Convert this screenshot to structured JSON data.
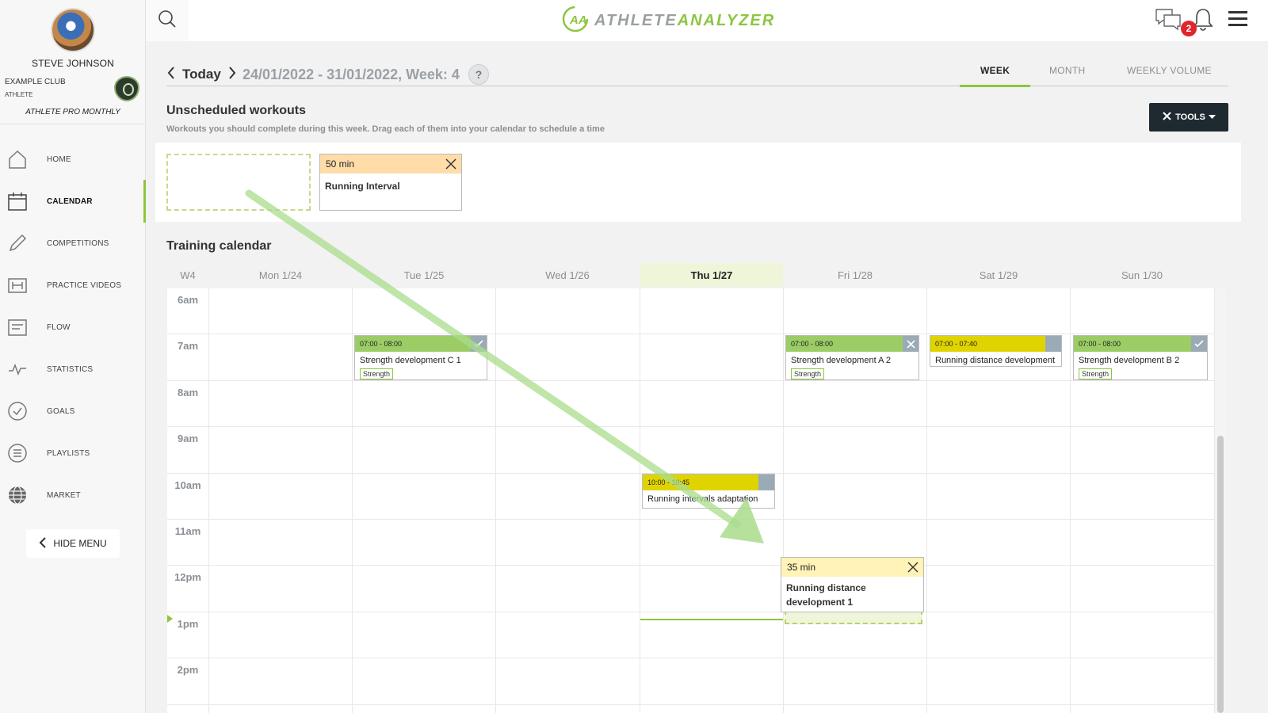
{
  "user": {
    "name": "STEVE JOHNSON",
    "club": "EXAMPLE CLUB",
    "role": "ATHLETE",
    "plan": "ATHLETE PRO MONTHLY"
  },
  "nav": {
    "items": [
      {
        "label": "HOME",
        "icon": "home-icon"
      },
      {
        "label": "CALENDAR",
        "icon": "calendar-icon"
      },
      {
        "label": "COMPETITIONS",
        "icon": "pencil-icon"
      },
      {
        "label": "PRACTICE VIDEOS",
        "icon": "video-icon"
      },
      {
        "label": "FLOW",
        "icon": "flow-icon"
      },
      {
        "label": "STATISTICS",
        "icon": "pulse-icon"
      },
      {
        "label": "GOALS",
        "icon": "check-circle-icon"
      },
      {
        "label": "PLAYLISTS",
        "icon": "list-icon"
      },
      {
        "label": "MARKET",
        "icon": "globe-icon"
      }
    ],
    "active": "CALENDAR",
    "hide_menu": "HIDE MENU"
  },
  "header": {
    "brand_prefix": "ATHLETE",
    "brand_accent": "ANALYZER",
    "notification_count": "2"
  },
  "date_bar": {
    "today": "Today",
    "range": "24/01/2022 - 31/01/2022, Week: 4",
    "help": "?"
  },
  "views": {
    "week": "WEEK",
    "month": "MONTH",
    "weekly_volume": "WEEKLY VOLUME",
    "active": "WEEK"
  },
  "unscheduled": {
    "title": "Unscheduled workouts",
    "subtitle": "Workouts you should complete during this week. Drag each of them into your calendar to schedule a time",
    "tools": "TOOLS",
    "workout": {
      "duration": "50 min",
      "name": "Running Interval"
    }
  },
  "calendar": {
    "title": "Training calendar",
    "week_label": "W4",
    "days": [
      "Mon 1/24",
      "Tue 1/25",
      "Wed 1/26",
      "Thu 1/27",
      "Fri 1/28",
      "Sat 1/29",
      "Sun 1/30"
    ],
    "today": "Thu 1/27",
    "hours": [
      "6am",
      "7am",
      "8am",
      "9am",
      "10am",
      "11am",
      "12pm",
      "1pm",
      "2pm"
    ],
    "events": [
      {
        "time": "07:00 - 08:00",
        "title": "Strength development C 1",
        "tag": "Strength",
        "status": "done",
        "color": "#9ccc65"
      },
      {
        "time": "07:00 - 08:00",
        "title": "Strength development A 2",
        "tag": "Strength",
        "status": "removed",
        "color": "#9ccc65"
      },
      {
        "time": "07:00 - 07:40",
        "title": "Running distance development",
        "tag": "",
        "status": "pending",
        "color": "#e0d400"
      },
      {
        "time": "07:00 - 08:00",
        "title": "Strength development B 2",
        "tag": "Strength",
        "status": "done",
        "color": "#9ccc65"
      },
      {
        "time": "10:00 - 10:45",
        "title": "Running intervals adaptation",
        "tag": "",
        "status": "pending",
        "color": "#e0d400"
      }
    ],
    "dragging": {
      "duration": "35 min",
      "name": "Running distance development 1"
    }
  },
  "colors": {
    "accent": "#8cc63f",
    "brand_gray": "#9aa0a0",
    "badge": "#e0262b",
    "tools_bg": "#1f2a30"
  }
}
